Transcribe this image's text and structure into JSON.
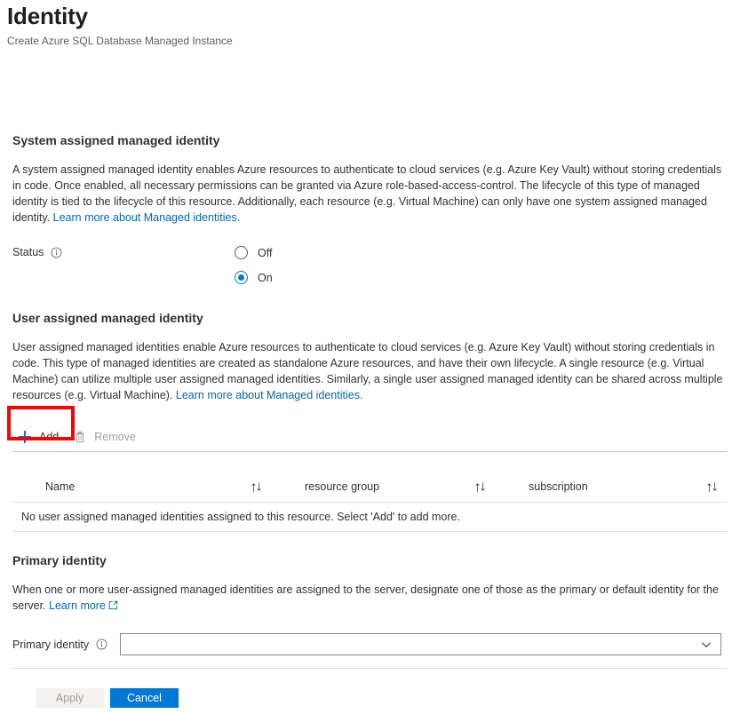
{
  "header": {
    "title": "Identity",
    "subtitle": "Create Azure SQL Database Managed Instance"
  },
  "system_identity": {
    "heading": "System assigned managed identity",
    "description": "A system assigned managed identity enables Azure resources to authenticate to cloud services (e.g. Azure Key Vault) without storing credentials in code. Once enabled, all necessary permissions can be granted via Azure role-based-access-control. The lifecycle of this type of managed identity is tied to the lifecycle of this resource. Additionally, each resource (e.g. Virtual Machine) can only have one system assigned managed identity. ",
    "learn_more": "Learn more about Managed identities.",
    "status_label": "Status",
    "options": [
      {
        "label": "Off",
        "selected": false
      },
      {
        "label": "On",
        "selected": true
      }
    ]
  },
  "user_identity": {
    "heading": "User assigned managed identity",
    "description": "User assigned managed identities enable Azure resources to authenticate to cloud services (e.g. Azure Key Vault) without storing credentials in code. This type of managed identities are created as standalone Azure resources, and have their own lifecycle. A single resource (e.g. Virtual Machine) can utilize multiple user assigned managed identities. Similarly, a single user assigned managed identity can be shared across multiple resources (e.g. Virtual Machine). ",
    "learn_more": "Learn more about Managed identities.",
    "toolbar": {
      "add_label": "Add",
      "remove_label": "Remove"
    },
    "table": {
      "columns": [
        "Name",
        "resource group",
        "subscription"
      ],
      "empty_message": "No user assigned managed identities assigned to this resource. Select 'Add' to add more.",
      "rows": []
    }
  },
  "primary_identity": {
    "heading": "Primary identity",
    "description": "When one or more user-assigned managed identities are assigned to the server, designate one of those as the primary or default identity for the server. ",
    "learn_more": "Learn more",
    "field_label": "Primary identity",
    "value": "",
    "options": []
  },
  "footer": {
    "apply_label": "Apply",
    "cancel_label": "Cancel"
  },
  "colors": {
    "accent": "#0078d4",
    "link": "#0067b8",
    "highlight": "#ff0000",
    "disabled_text": "#a19f9d"
  }
}
